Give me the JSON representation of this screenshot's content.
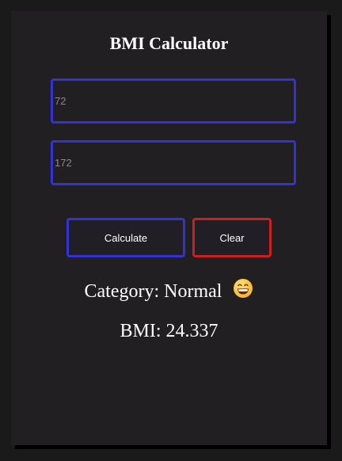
{
  "app": {
    "title": "BMI Calculator"
  },
  "inputs": {
    "weight": {
      "value": "",
      "placeholder": "72"
    },
    "height": {
      "value": "",
      "placeholder": "172"
    }
  },
  "buttons": {
    "calculate_label": "Calculate",
    "clear_label": "Clear"
  },
  "result": {
    "category_label": "Category:",
    "category_value": "Normal",
    "category_icon": "grinning-face-icon",
    "bmi_label": "BMI:",
    "bmi_value": "24.337"
  },
  "colors": {
    "page_background": "#1b1a1b",
    "card_background": "#211f22",
    "accent_blue": "#3333d4",
    "accent_red": "#cc2020",
    "text": "#ffffff"
  }
}
